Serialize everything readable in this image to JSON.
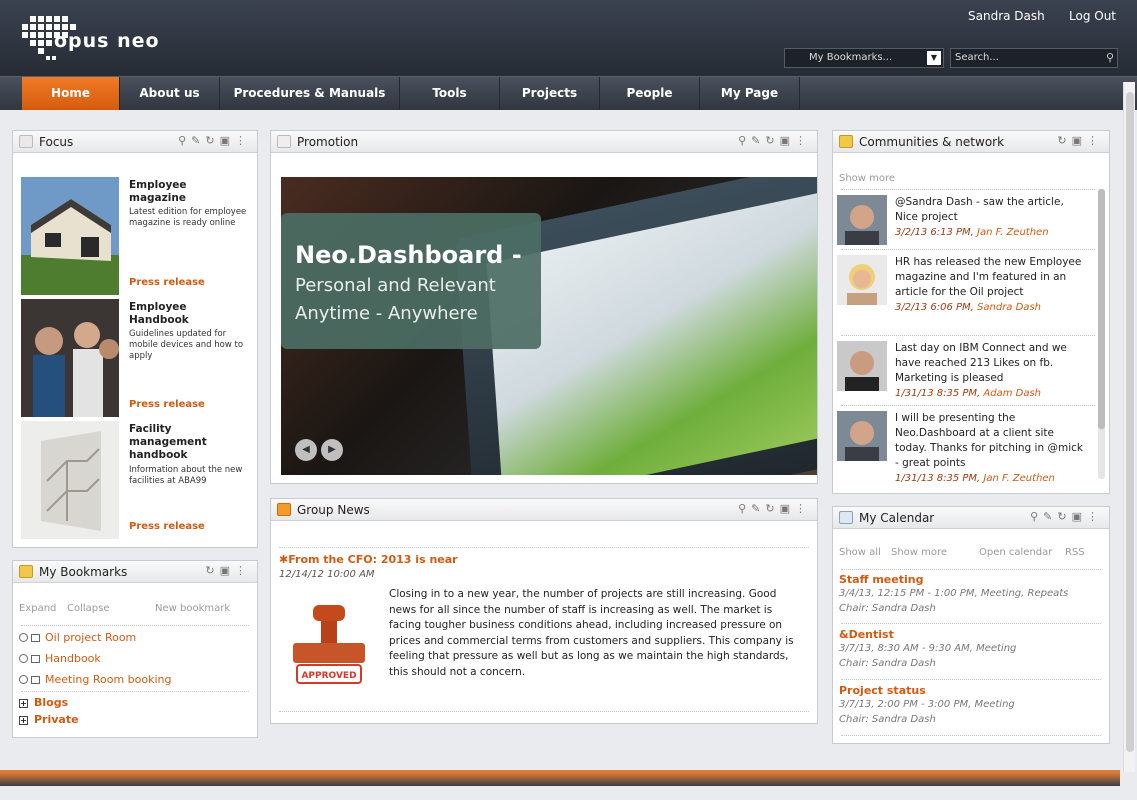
{
  "header": {
    "logo_text": "opus neo",
    "user_name": "Sandra Dash",
    "logout_label": "Log Out",
    "bookmarks_select": "My Bookmarks...",
    "search_placeholder": "Search..."
  },
  "nav": {
    "items": [
      "Home",
      "About us",
      "Procedures & Manuals",
      "Tools",
      "Projects",
      "People",
      "My Page"
    ]
  },
  "focus": {
    "title": "Focus",
    "items": [
      {
        "title": "Employee magazine",
        "desc": "Latest edition for employee magazine is ready online",
        "link": "Press release"
      },
      {
        "title": "Employee Handbook",
        "desc": "Guidelines updated for mobile devices and how to apply",
        "link": "Press release"
      },
      {
        "title": "Facility management handbook",
        "desc": "Information about the new facilities at ABA99",
        "link": "Press release"
      }
    ]
  },
  "promotion": {
    "title": "Promotion",
    "headline": "Neo.Dashboard -",
    "line2": "Personal and Relevant",
    "line3": "Anytime - Anywhere"
  },
  "community": {
    "title": "Communities & network",
    "show_more": "Show more",
    "posts": [
      {
        "text": "@Sandra Dash - saw the article, Nice project",
        "date": "3/2/13 6:13 PM,",
        "who": "Jan F. Zeuthen"
      },
      {
        "text": "HR has released the new Employee magazine and I'm featured in an article for the Oil project",
        "date": "3/2/13 6:06 PM,",
        "who": "Sandra Dash"
      },
      {
        "text": "Last day on IBM Connect and we have reached 213 Likes on fb. Marketing is pleased",
        "date": "1/31/13 8:35 PM,",
        "who": "Adam Dash"
      },
      {
        "text": "I will be presenting the Neo.Dashboard at a client site today. Thanks for pitching in @mick - great points",
        "date": "1/31/13 8:35 PM,",
        "who": "Jan F. Zeuthen"
      }
    ]
  },
  "group_news": {
    "title": "Group News",
    "headline": "From the CFO: 2013 is near",
    "date": "12/14/12 10:00 AM",
    "body": "Closing in to a new year, the number of projects are still increasing. Good news for all since the number of staff is increasing as well. The market is facing tougher business conditions ahead, including increased pressure on prices and commercial terms from customers and suppliers. This company is feeling that pressure as well but as long as we maintain the high standards, this should not a concern.",
    "stamp_label": "APPROVED"
  },
  "bookmarks": {
    "title": "My Bookmarks",
    "expand": "Expand",
    "collapse": "Collapse",
    "new_bookmark": "New bookmark",
    "items": [
      "Oil project Room",
      "Handbook",
      "Meeting Room booking"
    ],
    "folders": [
      "Blogs",
      "Private"
    ]
  },
  "calendar": {
    "title": "My Calendar",
    "show_all": "Show all",
    "show_more": "Show more",
    "open_calendar": "Open calendar",
    "rss": "RSS",
    "events": [
      {
        "title": "Staff meeting",
        "time": "3/4/13, 12:15 PM - 1:00 PM, Meeting, Repeats",
        "chair": "Chair: Sandra Dash"
      },
      {
        "title": "&Dentist",
        "time": "3/7/13, 8:30 AM - 9:30 AM, Meeting",
        "chair": "Chair: Sandra Dash"
      },
      {
        "title": "Project status",
        "time": "3/7/13, 2:00 PM - 3:00 PM, Meeting",
        "chair": "Chair: Sandra Dash"
      }
    ]
  },
  "colors": {
    "accent": "#d25a11",
    "nav_active": "#e86a1a",
    "header": "#2e333c"
  }
}
